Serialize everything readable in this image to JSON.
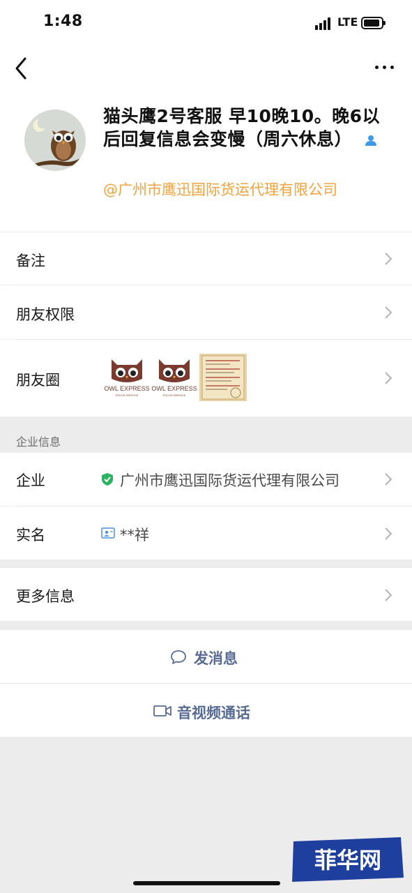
{
  "status_bar": {
    "time": "1:48",
    "network": "LTE"
  },
  "profile": {
    "name": "猫头鹰2号客服 早10晚10。晚6以后回复信息会变慢（周六休息）",
    "company_tag": "@广州市鹰迅国际货运代理有限公司"
  },
  "rows": {
    "remark": "备注",
    "permissions": "朋友权限",
    "moments": "朋友圈",
    "moments_photos": [
      {
        "brand": "OWL EXPRESS",
        "sub": "FOCUS SERVICE"
      },
      {
        "brand": "OWL EXPRESS",
        "sub": "FOCUS SERVICE"
      }
    ]
  },
  "enterprise": {
    "section_title": "企业信息",
    "company_label": "企业",
    "company_value": "广州市鹰迅国际货运代理有限公司",
    "realname_label": "实名",
    "realname_value": "**祥"
  },
  "more_info": "更多信息",
  "actions": {
    "message": "发消息",
    "call": "音视频通话"
  },
  "watermark": "菲华网",
  "colors": {
    "company_tag": "#f0a33c",
    "action_text": "#576b95",
    "verified": "#2fb162",
    "bg": "#ececec"
  }
}
